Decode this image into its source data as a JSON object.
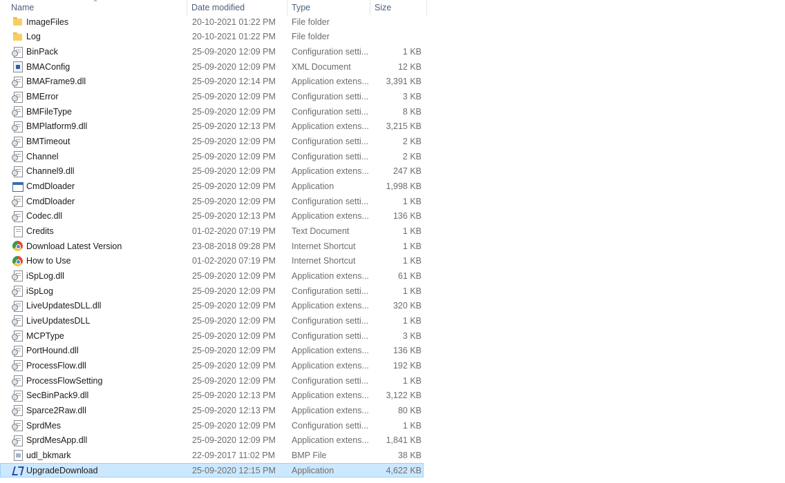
{
  "columns": {
    "name": "Name",
    "date": "Date modified",
    "type": "Type",
    "size": "Size"
  },
  "files": [
    {
      "name": "ImageFiles",
      "date": "20-10-2021 01:22 PM",
      "type": "File folder",
      "size": "",
      "icon": "folder-icon"
    },
    {
      "name": "Log",
      "date": "20-10-2021 01:22 PM",
      "type": "File folder",
      "size": "",
      "icon": "folder-icon"
    },
    {
      "name": "BinPack",
      "date": "25-09-2020 12:09 PM",
      "type": "Configuration setti...",
      "size": "1 KB",
      "icon": "config-file-icon"
    },
    {
      "name": "BMAConfig",
      "date": "25-09-2020 12:09 PM",
      "type": "XML Document",
      "size": "12 KB",
      "icon": "xml-file-icon"
    },
    {
      "name": "BMAFrame9.dll",
      "date": "25-09-2020 12:14 PM",
      "type": "Application extens...",
      "size": "3,391 KB",
      "icon": "dll-file-icon"
    },
    {
      "name": "BMError",
      "date": "25-09-2020 12:09 PM",
      "type": "Configuration setti...",
      "size": "3 KB",
      "icon": "config-file-icon"
    },
    {
      "name": "BMFileType",
      "date": "25-09-2020 12:09 PM",
      "type": "Configuration setti...",
      "size": "8 KB",
      "icon": "config-file-icon"
    },
    {
      "name": "BMPlatform9.dll",
      "date": "25-09-2020 12:13 PM",
      "type": "Application extens...",
      "size": "3,215 KB",
      "icon": "dll-file-icon"
    },
    {
      "name": "BMTimeout",
      "date": "25-09-2020 12:09 PM",
      "type": "Configuration setti...",
      "size": "2 KB",
      "icon": "config-file-icon"
    },
    {
      "name": "Channel",
      "date": "25-09-2020 12:09 PM",
      "type": "Configuration setti...",
      "size": "2 KB",
      "icon": "config-file-icon"
    },
    {
      "name": "Channel9.dll",
      "date": "25-09-2020 12:09 PM",
      "type": "Application extens...",
      "size": "247 KB",
      "icon": "dll-file-icon"
    },
    {
      "name": "CmdDloader",
      "date": "25-09-2020 12:09 PM",
      "type": "Application",
      "size": "1,998 KB",
      "icon": "application-icon"
    },
    {
      "name": "CmdDloader",
      "date": "25-09-2020 12:09 PM",
      "type": "Configuration setti...",
      "size": "1 KB",
      "icon": "config-file-icon"
    },
    {
      "name": "Codec.dll",
      "date": "25-09-2020 12:13 PM",
      "type": "Application extens...",
      "size": "136 KB",
      "icon": "dll-file-icon"
    },
    {
      "name": "Credits",
      "date": "01-02-2020 07:19 PM",
      "type": "Text Document",
      "size": "1 KB",
      "icon": "text-file-icon"
    },
    {
      "name": "Download Latest Version",
      "date": "23-08-2018 09:28 PM",
      "type": "Internet Shortcut",
      "size": "1 KB",
      "icon": "internet-shortcut-icon"
    },
    {
      "name": "How to Use",
      "date": "01-02-2020 07:19 PM",
      "type": "Internet Shortcut",
      "size": "1 KB",
      "icon": "internet-shortcut-icon"
    },
    {
      "name": "iSpLog.dll",
      "date": "25-09-2020 12:09 PM",
      "type": "Application extens...",
      "size": "61 KB",
      "icon": "dll-file-icon"
    },
    {
      "name": "iSpLog",
      "date": "25-09-2020 12:09 PM",
      "type": "Configuration setti...",
      "size": "1 KB",
      "icon": "config-file-icon"
    },
    {
      "name": "LiveUpdatesDLL.dll",
      "date": "25-09-2020 12:09 PM",
      "type": "Application extens...",
      "size": "320 KB",
      "icon": "dll-file-icon"
    },
    {
      "name": "LiveUpdatesDLL",
      "date": "25-09-2020 12:09 PM",
      "type": "Configuration setti...",
      "size": "1 KB",
      "icon": "config-file-icon"
    },
    {
      "name": "MCPType",
      "date": "25-09-2020 12:09 PM",
      "type": "Configuration setti...",
      "size": "3 KB",
      "icon": "config-file-icon"
    },
    {
      "name": "PortHound.dll",
      "date": "25-09-2020 12:09 PM",
      "type": "Application extens...",
      "size": "136 KB",
      "icon": "dll-file-icon"
    },
    {
      "name": "ProcessFlow.dll",
      "date": "25-09-2020 12:09 PM",
      "type": "Application extens...",
      "size": "192 KB",
      "icon": "dll-file-icon"
    },
    {
      "name": "ProcessFlowSetting",
      "date": "25-09-2020 12:09 PM",
      "type": "Configuration setti...",
      "size": "1 KB",
      "icon": "config-file-icon"
    },
    {
      "name": "SecBinPack9.dll",
      "date": "25-09-2020 12:13 PM",
      "type": "Application extens...",
      "size": "3,122 KB",
      "icon": "dll-file-icon"
    },
    {
      "name": "Sparce2Raw.dll",
      "date": "25-09-2020 12:13 PM",
      "type": "Application extens...",
      "size": "80 KB",
      "icon": "dll-file-icon"
    },
    {
      "name": "SprdMes",
      "date": "25-09-2020 12:09 PM",
      "type": "Configuration setti...",
      "size": "1 KB",
      "icon": "config-file-icon"
    },
    {
      "name": "SprdMesApp.dll",
      "date": "25-09-2020 12:09 PM",
      "type": "Application extens...",
      "size": "1,841 KB",
      "icon": "dll-file-icon"
    },
    {
      "name": "udl_bkmark",
      "date": "22-09-2017 11:02 PM",
      "type": "BMP File",
      "size": "38 KB",
      "icon": "bmp-file-icon"
    },
    {
      "name": "UpgradeDownload",
      "date": "25-09-2020 12:15 PM",
      "type": "Application",
      "size": "4,622 KB",
      "icon": "upgrade-app-icon",
      "selected": true
    }
  ]
}
